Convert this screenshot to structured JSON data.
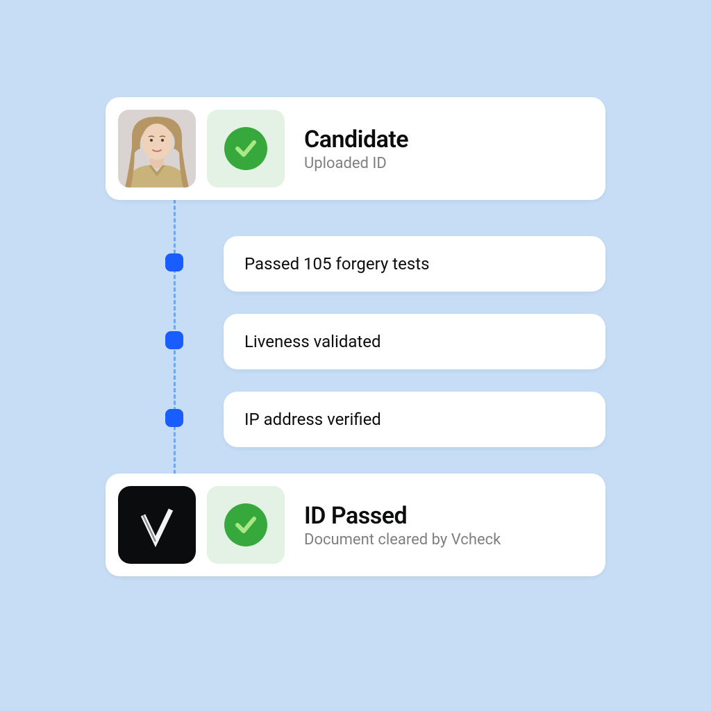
{
  "colors": {
    "page_bg": "#c6ddf5",
    "card_bg": "#ffffff",
    "accent_blue": "#1a5dff",
    "connector": "#6fa8ef",
    "success_bg": "#e3f2e4",
    "success": "#37a93c",
    "text_primary": "#0b0c0d",
    "text_secondary": "#7d7f82"
  },
  "top_card": {
    "title": "Candidate",
    "subtitle": "Uploaded ID",
    "avatar_icon": "person-photo",
    "status_icon": "checkmark-icon"
  },
  "steps": [
    {
      "label": "Passed 105 forgery tests"
    },
    {
      "label": "Liveness validated"
    },
    {
      "label": "IP address verified"
    }
  ],
  "bottom_card": {
    "title": "ID Passed",
    "subtitle": "Document cleared by Vcheck",
    "logo_icon": "vcheck-logo",
    "status_icon": "checkmark-icon"
  }
}
